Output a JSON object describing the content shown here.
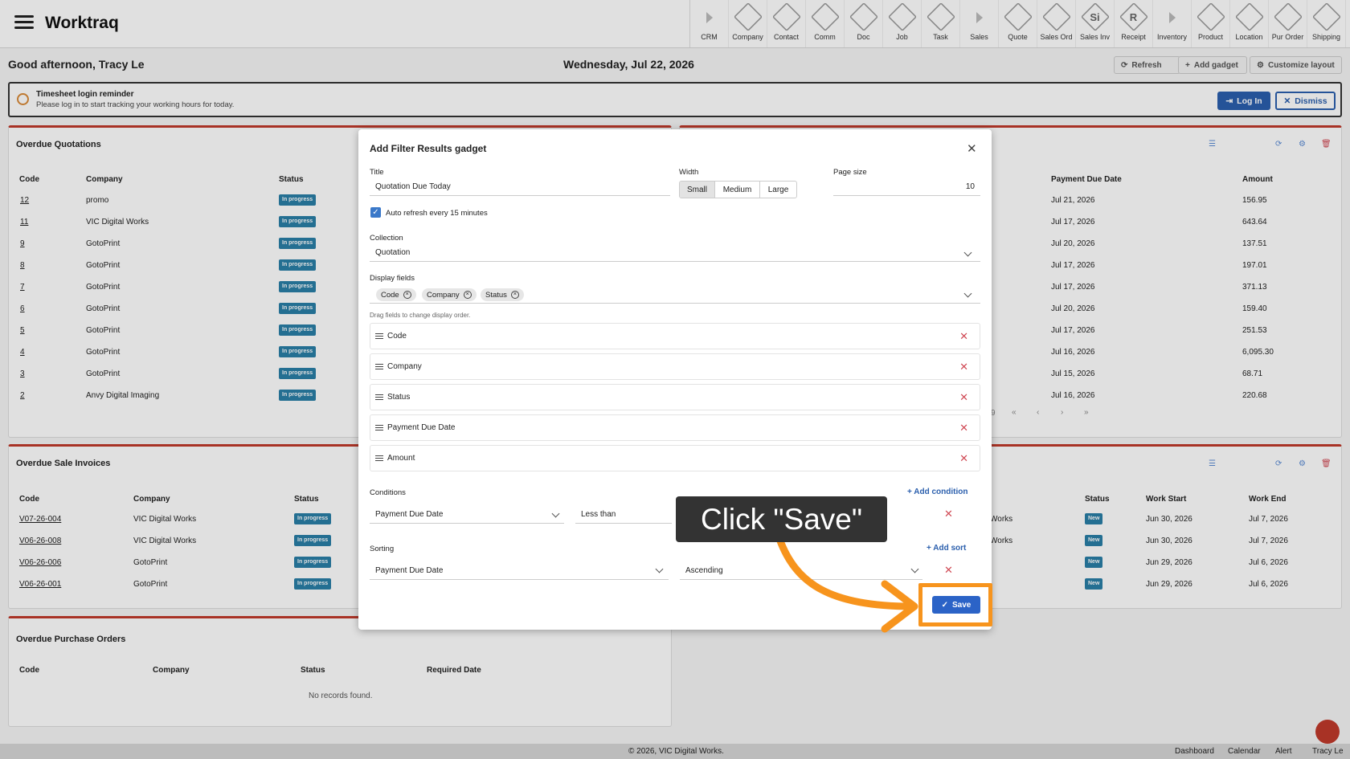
{
  "app": {
    "title": "Worktraq"
  },
  "modules": [
    {
      "label": "CRM",
      "icon": "arrow-icon",
      "sep": true
    },
    {
      "label": "Company",
      "icon": "company-icon"
    },
    {
      "label": "Contact",
      "icon": "contact-icon"
    },
    {
      "label": "Comm",
      "icon": "comm-icon"
    },
    {
      "label": "Doc",
      "icon": "doc-icon"
    },
    {
      "label": "Job",
      "icon": "job-icon"
    },
    {
      "label": "Task",
      "icon": "task-icon"
    },
    {
      "label": "Sales",
      "icon": "arrow-icon",
      "sep": true
    },
    {
      "label": "Quote",
      "icon": "quote-icon"
    },
    {
      "label": "Sales Ord",
      "icon": "sales-order-icon"
    },
    {
      "label": "Sales Inv",
      "icon": "sales-invoice-icon",
      "glyph": "Si"
    },
    {
      "label": "Receipt",
      "icon": "receipt-icon",
      "glyph": "R"
    },
    {
      "label": "Inventory",
      "icon": "arrow-icon",
      "sep": true
    },
    {
      "label": "Product",
      "icon": "product-icon"
    },
    {
      "label": "Location",
      "icon": "location-icon"
    },
    {
      "label": "Pur Order",
      "icon": "purchase-order-icon"
    },
    {
      "label": "Shipping",
      "icon": "shipping-icon"
    }
  ],
  "header": {
    "greeting": "Good afternoon, Tracy Le",
    "date": "Wednesday, Jul 22, 2026",
    "refresh": "Refresh",
    "add_gadget": "Add gadget",
    "customize": "Customize layout"
  },
  "reminder": {
    "title": "Timesheet login reminder",
    "text": "Please log in to start tracking your working hours for today.",
    "login": "Log In",
    "dismiss": "Dismiss"
  },
  "quotations": {
    "title": "Overdue Quotations",
    "headers": [
      "Code",
      "Company",
      "Status"
    ],
    "right_headers": [
      "Payment Due Date",
      "Amount"
    ],
    "rows": [
      {
        "code": "12",
        "company": "promo",
        "status": "In progress",
        "due": "Jul 21, 2026",
        "amount": "156.95"
      },
      {
        "code": "11",
        "company": "VIC Digital Works",
        "status": "In progress",
        "due": "Jul 17, 2026",
        "amount": "643.64"
      },
      {
        "code": "9",
        "company": "GotoPrint",
        "status": "In progress",
        "due": "Jul 20, 2026",
        "amount": "137.51"
      },
      {
        "code": "8",
        "company": "GotoPrint",
        "status": "In progress",
        "due": "Jul 17, 2026",
        "amount": "197.01"
      },
      {
        "code": "7",
        "company": "GotoPrint",
        "status": "In progress",
        "due": "Jul 17, 2026",
        "amount": "371.13"
      },
      {
        "code": "6",
        "company": "GotoPrint",
        "status": "In progress",
        "due": "Jul 20, 2026",
        "amount": "159.40"
      },
      {
        "code": "5",
        "company": "GotoPrint",
        "status": "In progress",
        "due": "Jul 17, 2026",
        "amount": "251.53"
      },
      {
        "code": "4",
        "company": "GotoPrint",
        "status": "In progress",
        "due": "Jul 16, 2026",
        "amount": "6,095.30"
      },
      {
        "code": "3",
        "company": "GotoPrint",
        "status": "In progress",
        "due": "Jul 15, 2026",
        "amount": "68.71"
      },
      {
        "code": "2",
        "company": "Anvy Digital Imaging",
        "status": "In progress",
        "due": "Jul 16, 2026",
        "amount": "220.68"
      }
    ],
    "pager": "9"
  },
  "invoices": {
    "title": "Overdue Sale Invoices",
    "headers": [
      "Code",
      "Company",
      "Status"
    ],
    "rows": [
      {
        "code": "V07-26-004",
        "company": "VIC Digital Works",
        "status": "In progress"
      },
      {
        "code": "V06-26-008",
        "company": "VIC Digital Works",
        "status": "In progress"
      },
      {
        "code": "V06-26-006",
        "company": "GotoPrint",
        "status": "In progress"
      },
      {
        "code": "V06-26-001",
        "company": "GotoPrint",
        "status": "In progress"
      }
    ]
  },
  "jobs": {
    "headers": [
      "Status",
      "Work Start",
      "Work End"
    ],
    "rows": [
      {
        "company": "Works",
        "status": "New",
        "start": "Jun 30, 2026",
        "end": "Jul 7, 2026"
      },
      {
        "company": "Works",
        "status": "New",
        "start": "Jun 30, 2026",
        "end": "Jul 7, 2026"
      },
      {
        "company": "",
        "status": "New",
        "start": "Jun 29, 2026",
        "end": "Jul 6, 2026"
      },
      {
        "company": "",
        "status": "New",
        "start": "Jun 29, 2026",
        "end": "Jul 6, 2026"
      }
    ]
  },
  "purchase": {
    "title": "Overdue Purchase Orders",
    "headers": [
      "Code",
      "Company",
      "Status",
      "Required Date"
    ],
    "empty": "No records found."
  },
  "modal": {
    "title": "Add Filter Results gadget",
    "title_label": "Title",
    "title_value": "Quotation Due Today",
    "width_label": "Width",
    "width_options": [
      "Small",
      "Medium",
      "Large"
    ],
    "width_selected": "Small",
    "pagesize_label": "Page size",
    "pagesize_value": "10",
    "auto_refresh": "Auto refresh every 15 minutes",
    "collection_label": "Collection",
    "collection_value": "Quotation",
    "display_label": "Display fields",
    "chips": [
      "Code",
      "Company",
      "Status"
    ],
    "drag_hint": "Drag fields to change display order.",
    "fields": [
      "Code",
      "Company",
      "Status",
      "Payment Due Date",
      "Amount"
    ],
    "conditions_label": "Conditions",
    "add_condition": "Add condition",
    "cond_field": "Payment Due Date",
    "cond_op": "Less than",
    "sorting_label": "Sorting",
    "add_sort": "Add sort",
    "sort_field": "Payment Due Date",
    "sort_dir": "Ascending",
    "save": "Save"
  },
  "callout": {
    "text": "Click \"Save\"",
    "color": "#f7941d"
  },
  "footer": {
    "copyright": "© 2026, VIC Digital Works.",
    "links": [
      "Dashboard",
      "Calendar",
      "Alert",
      "Tracy Le"
    ]
  }
}
